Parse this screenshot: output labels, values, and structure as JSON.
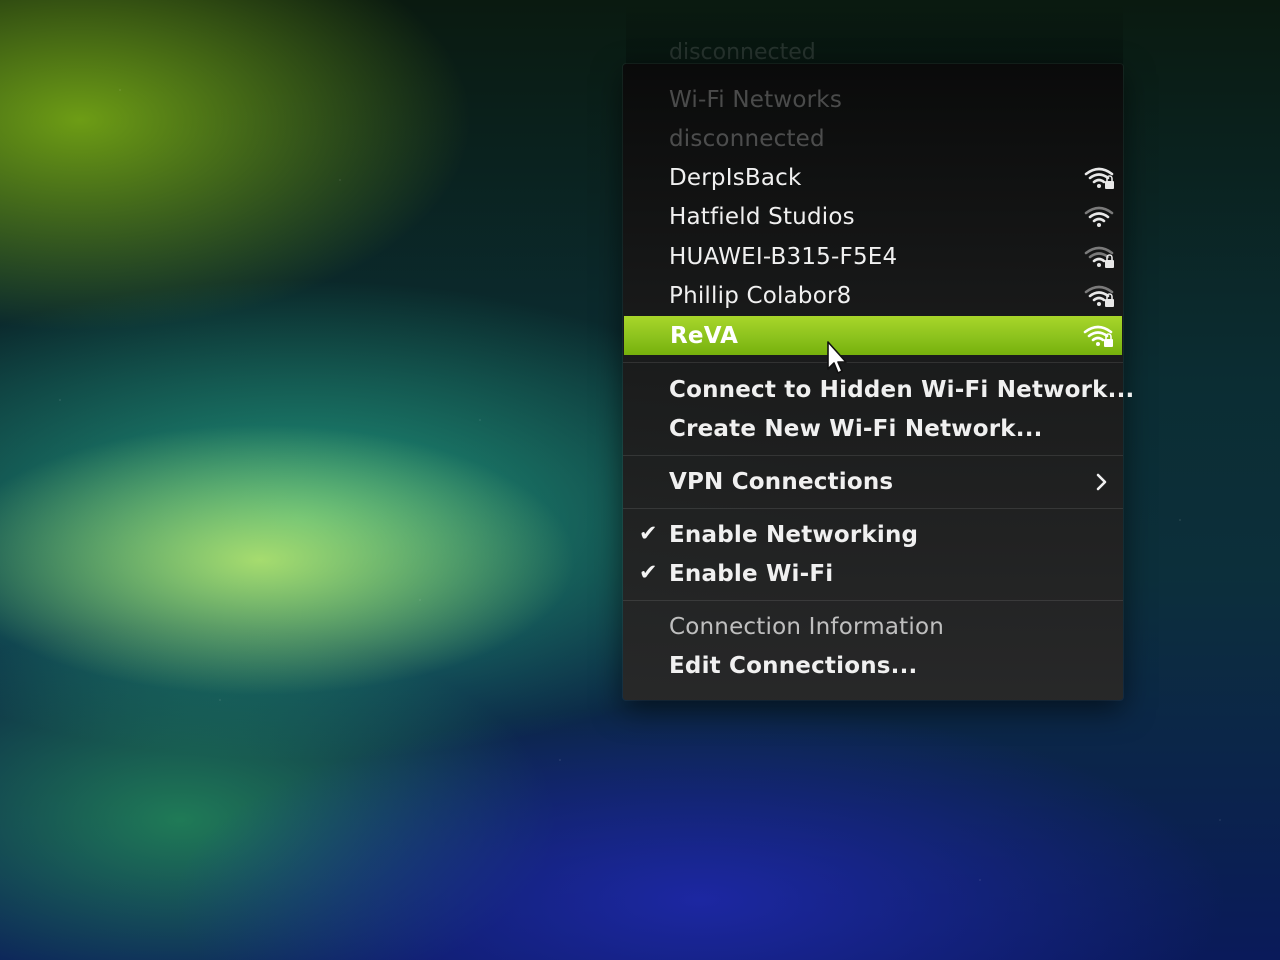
{
  "menu": {
    "ghost_top_text": "disconnected",
    "wifi_section": {
      "header": "Wi-Fi Networks",
      "status": "disconnected",
      "networks": [
        {
          "name": "DerpIsBack",
          "signal_level": 3,
          "locked": true
        },
        {
          "name": "Hatfield Studios",
          "signal_level": 2,
          "locked": false
        },
        {
          "name": "HUAWEI-B315-F5E4",
          "signal_level": 1,
          "locked": true
        },
        {
          "name": "Phillip Colabor8",
          "signal_level": 2,
          "locked": true
        },
        {
          "name": "ReVA",
          "signal_level": 3,
          "locked": true,
          "selected": true
        }
      ]
    },
    "actions": {
      "connect_hidden": "Connect to Hidden Wi-Fi Network...",
      "create_new": "Create New Wi-Fi Network..."
    },
    "vpn": {
      "label": "VPN Connections",
      "chevron_icon": "chevron-right-icon"
    },
    "toggles": {
      "enable_networking": {
        "label": "Enable Networking",
        "checked": true
      },
      "enable_wifi": {
        "label": "Enable Wi-Fi",
        "checked": true
      }
    },
    "info": {
      "connection_information": "Connection Information",
      "edit_connections": "Edit Connections..."
    },
    "check_glyph": "✔"
  },
  "colors": {
    "selection_green": "#8cc21d",
    "menu_bg": "#1e1e1e",
    "text": "#f0f0f0",
    "disabled_text": "rgba(255,255,255,0.26)"
  }
}
